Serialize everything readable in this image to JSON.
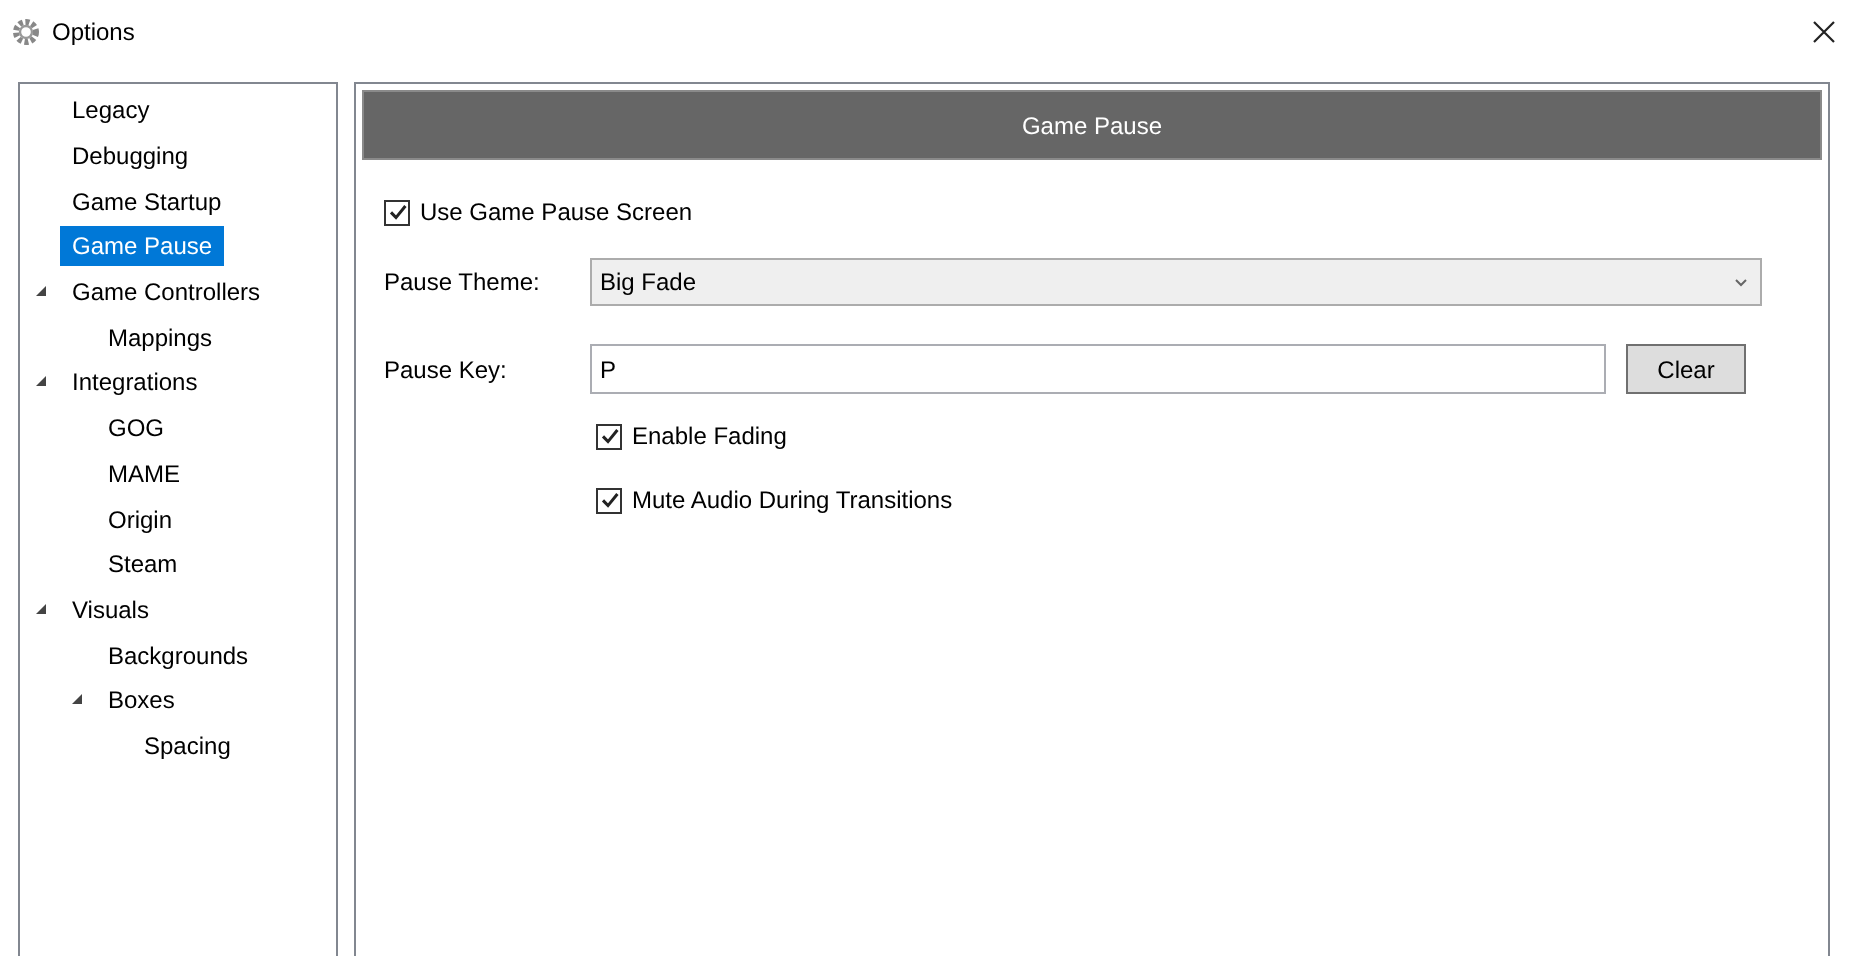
{
  "window": {
    "title": "Options"
  },
  "sidebar": {
    "items": [
      {
        "label": "Legacy",
        "selected": false
      },
      {
        "label": "Debugging",
        "selected": false
      },
      {
        "label": "Game Startup",
        "selected": false
      },
      {
        "label": "Game Pause",
        "selected": true
      },
      {
        "label": "Game Controllers",
        "selected": false,
        "expanded": true,
        "children": [
          {
            "label": "Mappings",
            "selected": false
          }
        ]
      },
      {
        "label": "Integrations",
        "selected": false,
        "expanded": true,
        "children": [
          {
            "label": "GOG",
            "selected": false
          },
          {
            "label": "MAME",
            "selected": false
          },
          {
            "label": "Origin",
            "selected": false
          },
          {
            "label": "Steam",
            "selected": false
          }
        ]
      },
      {
        "label": "Visuals",
        "selected": false,
        "expanded": true,
        "children": [
          {
            "label": "Backgrounds",
            "selected": false
          },
          {
            "label": "Boxes",
            "selected": false,
            "expanded": true,
            "children": [
              {
                "label": "Spacing",
                "selected": false
              }
            ]
          }
        ]
      }
    ]
  },
  "panel": {
    "header": "Game Pause",
    "use_pause_screen": {
      "label": "Use Game Pause Screen",
      "checked": true
    },
    "pause_theme": {
      "label": "Pause Theme:",
      "value": "Big Fade"
    },
    "pause_key": {
      "label": "Pause Key:",
      "value": "P",
      "button": "Clear"
    },
    "options": [
      {
        "label": "Enable Fading",
        "checked": true
      },
      {
        "label": "Mute Audio During Transitions",
        "checked": true
      }
    ]
  }
}
